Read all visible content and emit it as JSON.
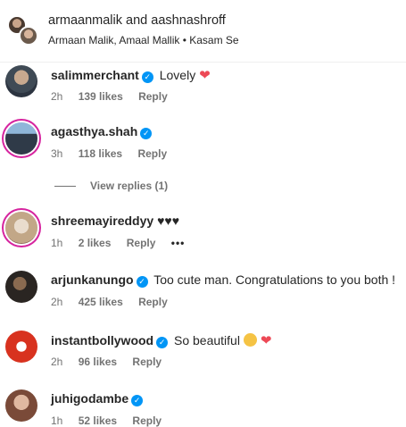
{
  "header": {
    "title": "armaanmalik and aashnashroff",
    "subtitle": "Armaan Malik, Amaal Mallik • Kasam Se"
  },
  "comments": [
    {
      "username": "salimmerchant",
      "text": "Lovely",
      "emoji": "❤",
      "time": "2h",
      "likes": "139 likes",
      "reply": "Reply"
    },
    {
      "username": "agasthya.shah",
      "text": "",
      "emoji": "",
      "time": "3h",
      "likes": "118 likes",
      "reply": "Reply",
      "view_replies": "View replies (1)"
    },
    {
      "username": "shreemayireddyy",
      "text": "",
      "emoji": "♥♥♥",
      "time": "1h",
      "likes": "2 likes",
      "reply": "Reply",
      "more": "•••"
    },
    {
      "username": "arjunkanungo",
      "text": "Too cute man. Congratulations to you both !",
      "emoji": "",
      "time": "2h",
      "likes": "425 likes",
      "reply": "Reply"
    },
    {
      "username": "instantbollywood",
      "text": "So beautiful",
      "emoji": "❤",
      "time": "2h",
      "likes": "96 likes",
      "reply": "Reply"
    },
    {
      "username": "juhigodambe",
      "text": "",
      "emoji": "",
      "time": "1h",
      "likes": "52 likes",
      "reply": "Reply"
    }
  ],
  "icons": {
    "verified": "verified-check-icon",
    "heart": "red-heart-icon",
    "more": "more-options-icon"
  },
  "colors": {
    "verified": "#0095f6",
    "heart": "#ed4956",
    "meta": "#737373"
  }
}
